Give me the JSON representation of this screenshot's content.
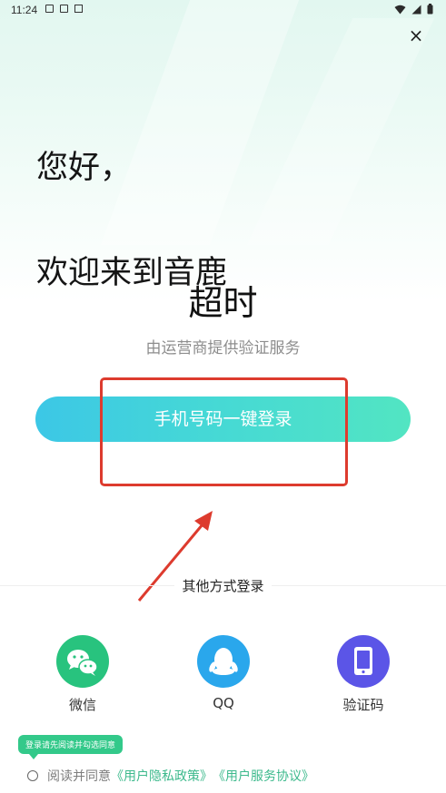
{
  "status_bar": {
    "time": "11:24"
  },
  "header": {
    "close_label": "×"
  },
  "greeting": {
    "line1": "您好，",
    "line2": "欢迎来到音鹿"
  },
  "login": {
    "phone_display": "超时",
    "provider_text": "由运营商提供验证服务",
    "button_label": "手机号码一键登录"
  },
  "other_methods": {
    "title": "其他方式登录",
    "options": [
      {
        "label": "微信",
        "icon": "wechat-icon",
        "color": "#28c37e"
      },
      {
        "label": "QQ",
        "icon": "qq-icon",
        "color": "#2aa7ec"
      },
      {
        "label": "验证码",
        "icon": "phone-verification-icon",
        "color": "#5b55e7"
      }
    ]
  },
  "agreement": {
    "tooltip": "登录请先阅读并勾选同意",
    "prefix": "阅读并同意",
    "privacy_policy": "《用户隐私政策》",
    "service_agreement": "《用户服务协议》"
  },
  "colors": {
    "accent_gradient_start": "#3cc7e6",
    "accent_gradient_end": "#52e5c2",
    "link": "#3cb98c",
    "annotation": "#dd3b2e"
  }
}
